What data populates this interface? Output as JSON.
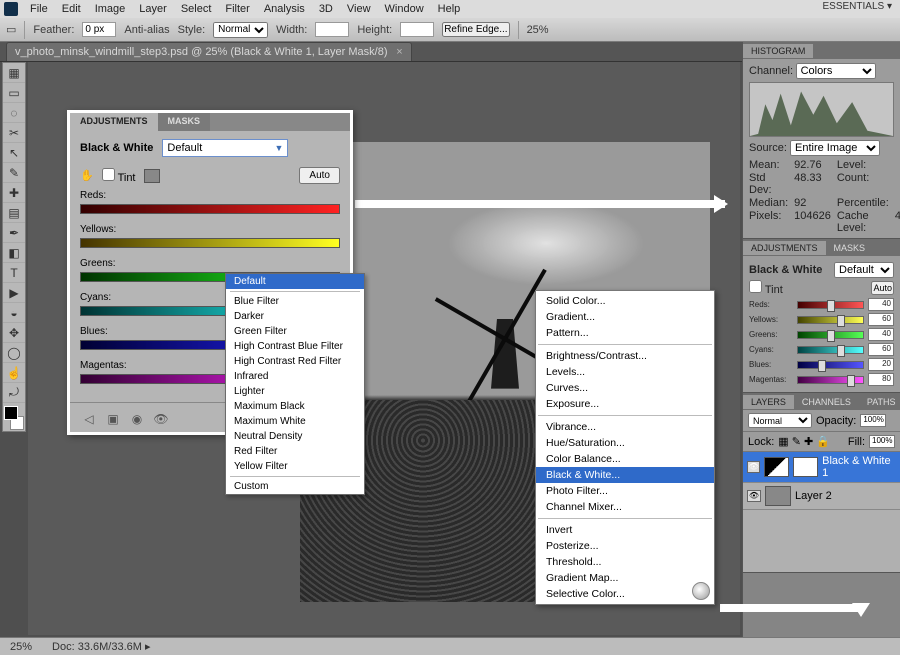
{
  "menubar": [
    "File",
    "Edit",
    "Image",
    "Layer",
    "Select",
    "Filter",
    "Analysis",
    "3D",
    "View",
    "Window",
    "Help"
  ],
  "essentials": "ESSENTIALS ▾",
  "optionsbar": {
    "feather_label": "Feather:",
    "feather_val": "0 px",
    "antialias": "Anti-alias",
    "style_label": "Style:",
    "style_val": "Normal",
    "width_label": "Width:",
    "height_label": "Height:",
    "refine": "Refine Edge...",
    "zoom": "25%"
  },
  "doc_tab": "v_photo_minsk_windmill_step3.psd @ 25% (Black & White 1, Layer Mask/8)",
  "tools": [
    "▦",
    "▭",
    "◌",
    "✂",
    "↖",
    "✎",
    "✚",
    "▤",
    "✒",
    "◧",
    "T",
    "▶",
    "◒",
    "✥",
    "◯",
    "☝",
    "⤾"
  ],
  "histogram": {
    "title": "HISTOGRAM",
    "channel_label": "Channel:",
    "channel": "Colors",
    "source_label": "Source:",
    "source": "Entire Image",
    "mean_l": "Mean:",
    "mean": "92.76",
    "level_l": "Level:",
    "std_l": "Std Dev:",
    "std": "48.33",
    "count_l": "Count:",
    "median_l": "Median:",
    "median": "92",
    "pct_l": "Percentile:",
    "pixels_l": "Pixels:",
    "pixels": "104626",
    "cache_l": "Cache Level:",
    "cache": "4"
  },
  "mini_adj": {
    "tab1": "ADJUSTMENTS",
    "tab2": "MASKS",
    "preset_label": "Black & White",
    "preset_val": "Default",
    "tint": "Tint",
    "auto": "Auto",
    "rows": [
      {
        "label": "Reds:",
        "val": "40",
        "c1": "#400",
        "c2": "#f55",
        "pos": "45%"
      },
      {
        "label": "Yellows:",
        "val": "60",
        "c1": "#440",
        "c2": "#ff5",
        "pos": "60%"
      },
      {
        "label": "Greens:",
        "val": "40",
        "c1": "#040",
        "c2": "#5f5",
        "pos": "45%"
      },
      {
        "label": "Cyans:",
        "val": "60",
        "c1": "#044",
        "c2": "#5ff",
        "pos": "60%"
      },
      {
        "label": "Blues:",
        "val": "20",
        "c1": "#004",
        "c2": "#55f",
        "pos": "30%"
      },
      {
        "label": "Magentas:",
        "val": "80",
        "c1": "#404",
        "c2": "#f5f",
        "pos": "75%"
      }
    ]
  },
  "layers": {
    "tab1": "LAYERS",
    "tab2": "CHANNELS",
    "tab3": "PATHS",
    "blend": "Normal",
    "opacity_l": "Opacity:",
    "opacity": "100%",
    "lock_l": "Lock:",
    "fill_l": "Fill:",
    "fill": "100%",
    "items": [
      {
        "name": "Black & White 1",
        "sel": true,
        "bw": true
      },
      {
        "name": "Layer 2",
        "sel": false,
        "bw": false
      }
    ]
  },
  "status": {
    "zoom": "25%",
    "doc_l": "Doc:",
    "doc": "33.6M/33.6M"
  },
  "float_adj": {
    "tab1": "ADJUSTMENTS",
    "tab2": "MASKS",
    "label": "Black & White",
    "preset_shown": "Default",
    "tint": "Tint",
    "auto": "Auto",
    "sliders": [
      {
        "label": "Reds:",
        "ca": "#300",
        "cb": "#f22"
      },
      {
        "label": "Yellows:",
        "ca": "#430",
        "cb": "#ff2"
      },
      {
        "label": "Greens:",
        "ca": "#030",
        "cb": "#2f2"
      },
      {
        "label": "Cyans:",
        "ca": "#033",
        "cb": "#2ff"
      },
      {
        "label": "Blues:",
        "ca": "#003",
        "cb": "#22f"
      },
      {
        "label": "Magentas:",
        "ca": "#303",
        "cb": "#f2f"
      }
    ]
  },
  "preset_dropdown": [
    "Default",
    "",
    "Blue Filter",
    "Darker",
    "Green Filter",
    "High Contrast Blue Filter",
    "High Contrast Red Filter",
    "Infrared",
    "Lighter",
    "Maximum Black",
    "Maximum White",
    "Neutral Density",
    "Red Filter",
    "Yellow Filter",
    "",
    "Custom"
  ],
  "preset_selected": "Default",
  "ctx": [
    "Solid Color...",
    "Gradient...",
    "Pattern...",
    "",
    "Brightness/Contrast...",
    "Levels...",
    "Curves...",
    "Exposure...",
    "",
    "Vibrance...",
    "Hue/Saturation...",
    "Color Balance...",
    "Black & White...",
    "Photo Filter...",
    "Channel Mixer...",
    "",
    "Invert",
    "Posterize...",
    "Threshold...",
    "Gradient Map...",
    "Selective Color..."
  ],
  "ctx_selected": "Black & White..."
}
